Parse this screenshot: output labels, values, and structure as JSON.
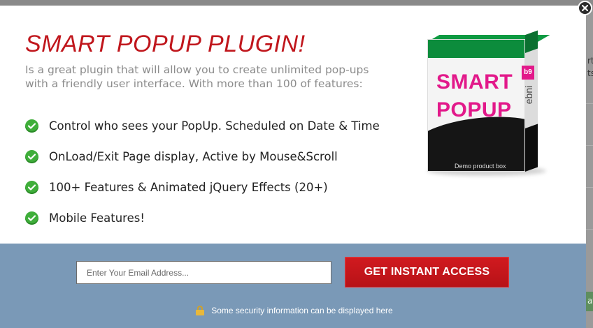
{
  "popup": {
    "title": "SMART POPUP PLUGIN!",
    "description": "Is a great plugin that will allow you to create unlimited pop-ups with a friendly user interface. With more than 100 of features:",
    "features": [
      {
        "text": "Control who sees your PopUp. Scheduled on Date & Time",
        "icon": "check-circle-icon"
      },
      {
        "text": "OnLoad/Exit Page display, Active by Mouse&Scroll",
        "icon": "check-circle-icon"
      },
      {
        "text": "100+ Features & Animated jQuery Effects (20+)",
        "icon": "check-circle-icon"
      },
      {
        "text": "Mobile Features!",
        "icon": "check-circle-icon"
      }
    ],
    "product_box": {
      "line1": "SMART",
      "line2": "POPUP",
      "side_brand": "ebni",
      "badge": "b9",
      "caption": "Demo product box"
    }
  },
  "footer": {
    "email_placeholder": "Enter Your Email Address...",
    "email_value": "",
    "cta_label": "GET INSTANT ACCESS",
    "security_text": "Some security information can be displayed here",
    "security_icon": "lock-icon"
  },
  "close_button": {
    "icon": "close-icon"
  },
  "background_page": {
    "fragments": [
      "rt",
      "ts",
      "at"
    ]
  },
  "colors": {
    "title": "#c0161c",
    "footer_bg": "#7a99b7",
    "cta_bg": "#c4151b",
    "check": "#3fae3a",
    "box_green": "#0c8c3c",
    "box_pink": "#e2198a"
  }
}
